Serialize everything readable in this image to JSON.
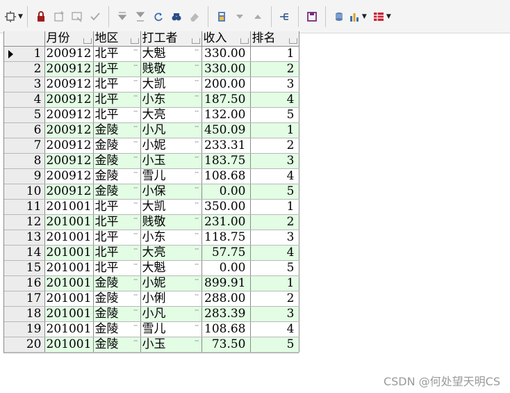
{
  "toolbar": {
    "icons": [
      "settings-dropdown-icon",
      "lock-icon",
      "add-row-icon",
      "cancel-icon",
      "confirm-icon",
      "move-down-icon",
      "move-bottom-icon",
      "refresh-icon",
      "find-icon",
      "clear-icon",
      "calculator-icon",
      "sort-desc-icon",
      "sort-asc-icon",
      "tree-icon",
      "save-icon",
      "database-icon",
      "chart-icon",
      "table-icon"
    ]
  },
  "grid": {
    "columns": [
      "月份",
      "地区",
      "打工者",
      "收入",
      "排名"
    ],
    "rows": [
      {
        "n": "1",
        "month": "200912",
        "region": "北平",
        "worker": "大魁",
        "income": "330.00",
        "rank": "1"
      },
      {
        "n": "2",
        "month": "200912",
        "region": "北平",
        "worker": "贱敬",
        "income": "330.00",
        "rank": "2"
      },
      {
        "n": "3",
        "month": "200912",
        "region": "北平",
        "worker": "大凯",
        "income": "200.00",
        "rank": "3"
      },
      {
        "n": "4",
        "month": "200912",
        "region": "北平",
        "worker": "小东",
        "income": "187.50",
        "rank": "4"
      },
      {
        "n": "5",
        "month": "200912",
        "region": "北平",
        "worker": "大亮",
        "income": "132.00",
        "rank": "5"
      },
      {
        "n": "6",
        "month": "200912",
        "region": "金陵",
        "worker": "小凡",
        "income": "450.09",
        "rank": "1"
      },
      {
        "n": "7",
        "month": "200912",
        "region": "金陵",
        "worker": "小妮",
        "income": "233.31",
        "rank": "2"
      },
      {
        "n": "8",
        "month": "200912",
        "region": "金陵",
        "worker": "小玉",
        "income": "183.75",
        "rank": "3"
      },
      {
        "n": "9",
        "month": "200912",
        "region": "金陵",
        "worker": "雪儿",
        "income": "108.68",
        "rank": "4"
      },
      {
        "n": "10",
        "month": "200912",
        "region": "金陵",
        "worker": "小保",
        "income": "0.00",
        "rank": "5"
      },
      {
        "n": "11",
        "month": "201001",
        "region": "北平",
        "worker": "大凯",
        "income": "350.00",
        "rank": "1"
      },
      {
        "n": "12",
        "month": "201001",
        "region": "北平",
        "worker": "贱敬",
        "income": "231.00",
        "rank": "2"
      },
      {
        "n": "13",
        "month": "201001",
        "region": "北平",
        "worker": "小东",
        "income": "118.75",
        "rank": "3"
      },
      {
        "n": "14",
        "month": "201001",
        "region": "北平",
        "worker": "大亮",
        "income": "57.75",
        "rank": "4"
      },
      {
        "n": "15",
        "month": "201001",
        "region": "北平",
        "worker": "大魁",
        "income": "0.00",
        "rank": "5"
      },
      {
        "n": "16",
        "month": "201001",
        "region": "金陵",
        "worker": "小妮",
        "income": "899.91",
        "rank": "1"
      },
      {
        "n": "17",
        "month": "201001",
        "region": "金陵",
        "worker": "小俐",
        "income": "288.00",
        "rank": "2"
      },
      {
        "n": "18",
        "month": "201001",
        "region": "金陵",
        "worker": "小凡",
        "income": "283.39",
        "rank": "3"
      },
      {
        "n": "19",
        "month": "201001",
        "region": "金陵",
        "worker": "雪儿",
        "income": "108.68",
        "rank": "4"
      },
      {
        "n": "20",
        "month": "201001",
        "region": "金陵",
        "worker": "小玉",
        "income": "73.50",
        "rank": "5"
      }
    ]
  },
  "watermark": "CSDN @何处望天明CS"
}
